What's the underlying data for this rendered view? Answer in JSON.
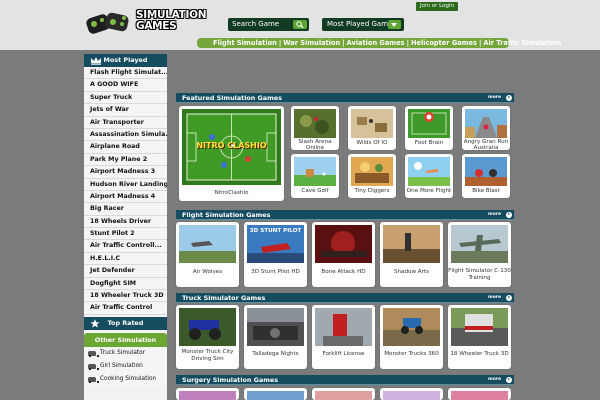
{
  "header": {
    "logo_text": "SIMULATION\nGAMES",
    "search_label": "Search Game",
    "mostplayed_select": "Most Played Games",
    "login_label": "Join or Login",
    "nav": [
      "Flight Simulation",
      "War Simulation",
      "Aviation Games",
      "Helicopter Games",
      "Air Traffic Simulation"
    ]
  },
  "sidebar": {
    "most_played_title": "Most Played",
    "most_played": [
      "Flash Flight Simulat...",
      "A GOOD WIFE",
      "Super Truck",
      "Jets of War",
      "Air Transporter",
      "Assassination Simula...",
      "Airplane Road",
      "Park My Plane 2",
      "Airport Madness 3",
      "Hudson River Landing",
      "Airport Madness 4",
      "Big Racer",
      "18 Wheels Driver",
      "Stunt Pilot 2",
      "Air Traffic Controll...",
      "H.E.L.I.C",
      "Jet Defender",
      "Dogfight SIM",
      "18 Wheeler Truck 3D",
      "Air Traffic Control"
    ],
    "top_rated_title": "Top Rated",
    "other_title": "Other Simulation",
    "other": [
      "Truck Simulator",
      "Girl Simulation",
      "Cooking Simulation"
    ]
  },
  "sections": {
    "featured": {
      "title": "Featured Simulation Games",
      "more": "more",
      "big": "NitroClashio",
      "big_thumb_text": "NITRO CLASHIO",
      "small": [
        "Slash Arena Online",
        "Wilds Of IO",
        "Foot Brain",
        "Angry Gran Run Australia",
        "Cave Golf",
        "Tiny Diggers",
        "One More Flight",
        "Bike Blast"
      ]
    },
    "flight": {
      "title": "Flight Simulation Games",
      "more": "more",
      "thumb_text": "3D STUNT PILOT",
      "games": [
        "Air Wolves",
        "3D Stunt Pilot HD",
        "Bone Attack HD",
        "Shadow Arts",
        "Flight Simulator C-130 Training"
      ]
    },
    "truck": {
      "title": "Truck Simulator Games",
      "more": "more",
      "games": [
        "Monster Truck City Driving Sim",
        "Talladega Nights",
        "Forklift License",
        "Monster Trucks 360",
        "18 Wheeler Truck 3D"
      ]
    },
    "surgery": {
      "title": "Surgery Simulation Games",
      "more": "more"
    }
  },
  "colors": {
    "nav_dark": "#154c5f",
    "green": "#6ca633",
    "search_bg": "#123b24",
    "content_bg": "#7b7b7b"
  }
}
